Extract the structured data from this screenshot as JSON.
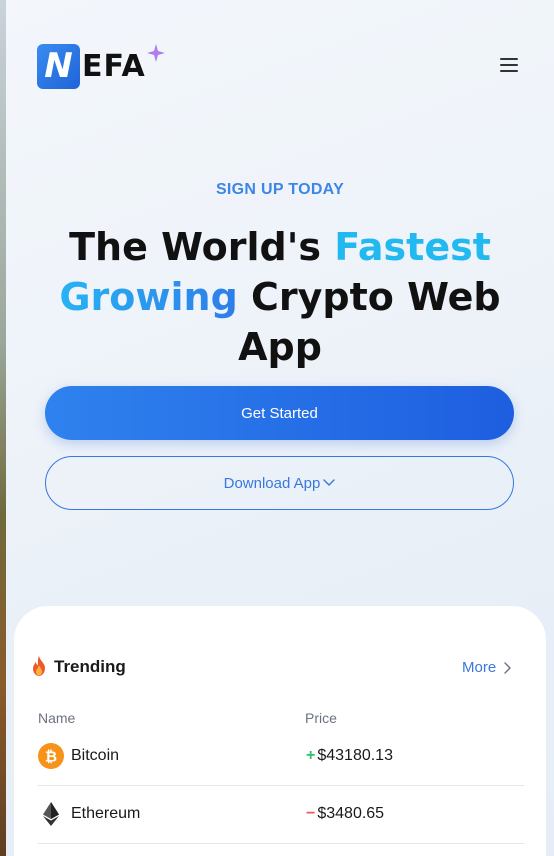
{
  "brand": {
    "badge_letter": "N",
    "name": "EFA"
  },
  "hero": {
    "kicker": "SIGN UP TODAY",
    "title_part1": "The World's ",
    "title_accent1": "Fastest",
    "title_accent2": "Growing",
    "title_part2": " Crypto Web App"
  },
  "actions": {
    "primary_label": "Get Started",
    "secondary_label": "Download App"
  },
  "trending": {
    "title": "Trending",
    "more_label": "More",
    "columns": {
      "name": "Name",
      "price": "Price"
    },
    "rows": [
      {
        "name": "Bitcoin",
        "change_sign": "+",
        "price": "$43180.13",
        "icon": "bitcoin-icon",
        "trend": "up"
      },
      {
        "name": "Ethereum",
        "change_sign": "−",
        "price": "$3480.65",
        "icon": "ethereum-icon",
        "trend": "down"
      }
    ]
  },
  "colors": {
    "accent_blue": "#2f7ee8",
    "accent_cyan": "#22b8f0",
    "positive": "#2cc26b",
    "negative": "#ef5a5a",
    "bitcoin": "#f7931a"
  }
}
